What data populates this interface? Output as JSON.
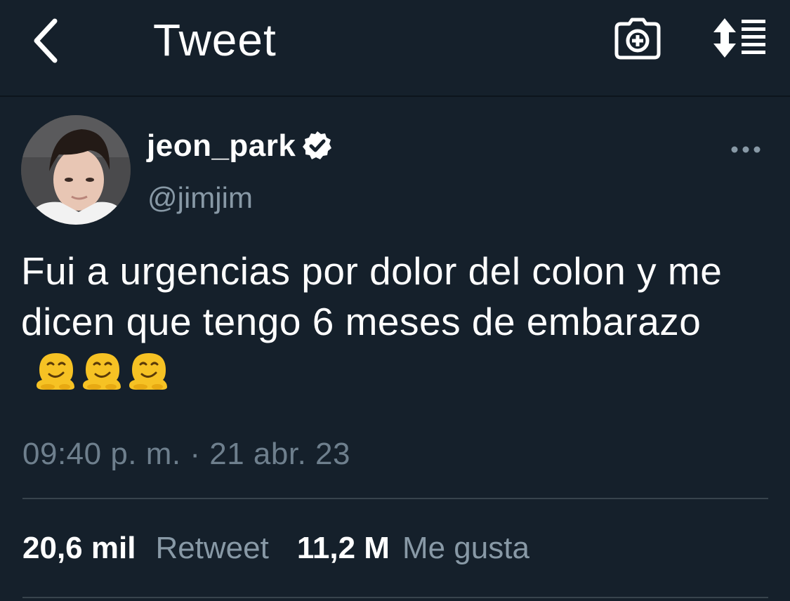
{
  "header": {
    "title": "Tweet",
    "back_icon": "chevron-left-icon",
    "camera_icon": "camera-add-icon",
    "sort_icon": "sort-list-icon"
  },
  "tweet": {
    "display_name": "jeon_park",
    "verified": true,
    "handle": "@jimjim",
    "text": "Fui a urgencias por dolor del colon y me dicen que tengo 6 meses de embarazo",
    "emojis": [
      "melting-face-emoji",
      "melting-face-emoji",
      "melting-face-emoji"
    ],
    "timestamp": "09:40 p. m. · 21 abr. 23"
  },
  "stats": {
    "retweets_count": "20,6 mil",
    "retweets_label": "Retweet",
    "likes_count": "11,2 M",
    "likes_label": "Me gusta"
  },
  "colors": {
    "background": "#15202b",
    "text_primary": "#ffffff",
    "text_secondary": "#8899a6",
    "divider": "#38444d"
  }
}
